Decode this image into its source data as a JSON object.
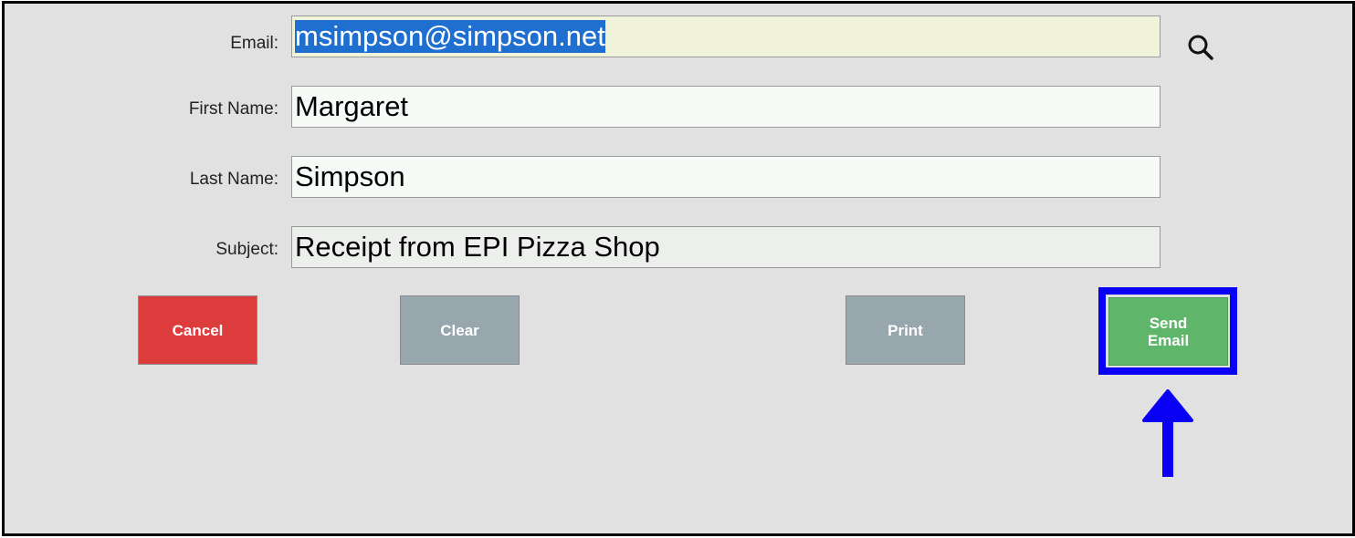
{
  "form": {
    "email": {
      "label": "Email:",
      "value": "msimpson@simpson.net"
    },
    "first_name": {
      "label": "First Name:",
      "value": "Margaret"
    },
    "last_name": {
      "label": "Last Name:",
      "value": "Simpson"
    },
    "subject": {
      "label": "Subject:",
      "value": "Receipt from EPI Pizza Shop"
    },
    "search_icon": "search-icon"
  },
  "buttons": {
    "cancel": "Cancel",
    "clear": "Clear",
    "print": "Print",
    "send_email": "Send\nEmail"
  },
  "colors": {
    "cancel": "#dc3c3c",
    "neutral": "#98a6ae",
    "send": "#5fb56a",
    "highlight": "#0a00f5",
    "selection": "#1f6fd0"
  },
  "annotation": {
    "highlight_icon": "highlight-box",
    "arrow_icon": "arrow-up-icon"
  }
}
